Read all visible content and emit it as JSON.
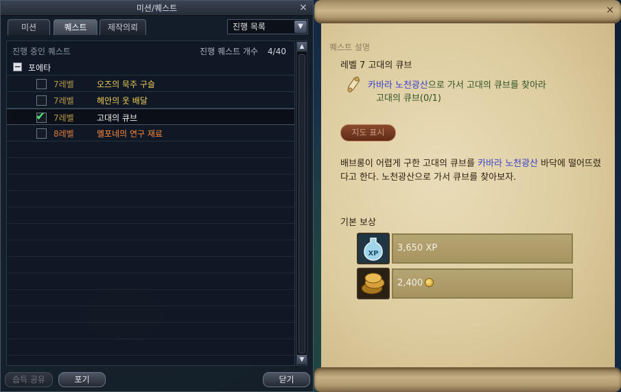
{
  "left_window": {
    "title": "미션/퀘스트",
    "close": "×",
    "tabs": [
      {
        "label": "미션",
        "active": false
      },
      {
        "label": "퀘스트",
        "active": true
      },
      {
        "label": "제작의뢰",
        "active": false
      }
    ],
    "dropdown": {
      "selected": "진행 목록",
      "arrow": "▼"
    },
    "list_header": {
      "in_progress_label": "진행 중인 퀘스트",
      "count_label": "진행 퀘스트 개수",
      "count_value": "4/40"
    },
    "group": {
      "toggle": "−",
      "label": "포에타"
    },
    "quests": [
      {
        "level": "7레벨",
        "name": "오즈의 묵주 구슬",
        "checked": false,
        "selected": false
      },
      {
        "level": "7레벨",
        "name": "헤안의 옷 배달",
        "checked": false,
        "selected": false
      },
      {
        "level": "7레벨",
        "name": "고대의 큐브",
        "checked": true,
        "selected": true
      },
      {
        "level": "8레벨",
        "name": "멜포네의 연구 재료",
        "checked": false,
        "selected": false
      }
    ],
    "scroll_up": "▲",
    "scroll_down": "▼",
    "buttons": {
      "share": "습득 공유",
      "abandon": "포기",
      "close": "닫기"
    }
  },
  "right_window": {
    "close": "×",
    "header": "퀘스트 설명",
    "quest_title": "레벨 7 고대의 큐브",
    "objective": {
      "location": "카바라 노천광산",
      "text": "으로 가서 고대의 큐브를 찾아라",
      "progress": "고대의 큐브(0/1)"
    },
    "map_button": "지도 표시",
    "description": {
      "part1": "배브롱이 어렵게 구한 고대의 큐브를 ",
      "location": "카바라 노천광산",
      "part2": " 바닥에 떨어뜨렸다고 한다. 노천광산으로 가서 큐브를 찾아보자."
    },
    "rewards_title": "기본 보상",
    "rewards": [
      {
        "icon": "xp-potion-icon",
        "value": "3,650 XP"
      },
      {
        "icon": "gold-coins-icon",
        "value": "2,400"
      }
    ]
  }
}
